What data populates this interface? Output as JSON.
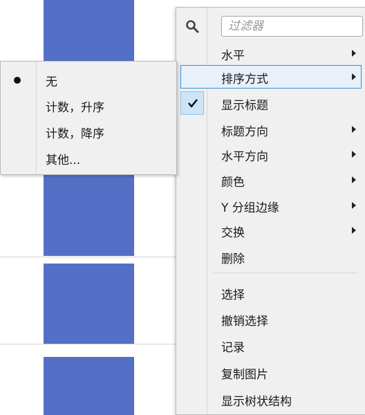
{
  "main_menu": {
    "filter_placeholder": "过滤器",
    "items": [
      {
        "label": "水平",
        "submenu": true
      },
      {
        "label": "排序方式",
        "submenu": true,
        "active": true
      },
      {
        "label": "显示标题",
        "checked": true
      },
      {
        "label": "标题方向",
        "submenu": true
      },
      {
        "label": "水平方向",
        "submenu": true
      },
      {
        "label": "颜色",
        "submenu": true
      },
      {
        "label": "Y 分组边缘",
        "submenu": true
      },
      {
        "label": "交换",
        "submenu": true
      },
      {
        "label": "删除"
      },
      {
        "label": "选择"
      },
      {
        "label": "撤销选择"
      },
      {
        "label": "记录"
      },
      {
        "label": "复制图片"
      },
      {
        "label": "显示树状结构"
      }
    ]
  },
  "sort_submenu": {
    "items": [
      {
        "label": "无",
        "selected": true
      },
      {
        "label": "计数，升序"
      },
      {
        "label": "计数，降序"
      },
      {
        "label": "其他..."
      }
    ]
  },
  "colors": {
    "bar": "#5470c6",
    "highlight_border": "#2f8fd6",
    "highlight_fill": "#e8f1fb",
    "menu_bg": "#f0f0f0"
  }
}
